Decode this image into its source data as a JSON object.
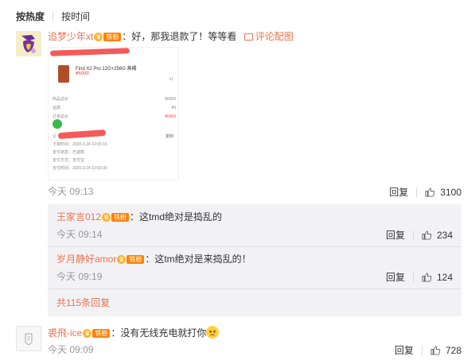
{
  "sort": {
    "active": "按热度",
    "other": "按时间"
  },
  "comments": [
    {
      "username": "追梦少年xt",
      "fan_label": "铁粉",
      "text": "：好，那我退款了！等等看",
      "pic_link": "评论配图",
      "time": "今天 09:13",
      "reply": "回复",
      "likes": "3100",
      "image": {
        "product_title": "Find X2 Pro 12G+256G 蒸橘",
        "product_price": "¥6999",
        "qty": "x1",
        "rows": [
          {
            "k": "商品总价",
            "v": "¥6999"
          },
          {
            "k": "运费",
            "v": "¥0"
          },
          {
            "k": "订单总价",
            "v": "¥6999"
          }
        ],
        "order_rows": [
          "订 单 号：",
          "下单时间：2020-3-24 10:03:16",
          "支付状态：已退款",
          "支付方式：支付宝",
          "支付时间：2020-3-24 10:03:39"
        ],
        "copy": "复制"
      },
      "replies": [
        {
          "username": "王家言012",
          "fan_label": "铁粉",
          "text": "：这tmd绝对是捣乱的",
          "time": "今天 09:14",
          "reply": "回复",
          "likes": "234"
        },
        {
          "username": "岁月静好amor",
          "fan_label": "铁粉",
          "text": "：这tm绝对是来捣乱的！",
          "time": "今天 09:19",
          "reply": "回复",
          "likes": "124"
        }
      ],
      "more_replies": "共115条回复"
    },
    {
      "username": "裘飛-ice",
      "fan_label": "铁粉",
      "text": "：没有无线充电就打你",
      "time": "今天 09:09",
      "reply": "回复",
      "likes": "728"
    }
  ],
  "colors": {
    "username": "#eb7350",
    "fan_badge": "#ff8200",
    "sub_bg": "#f2f2f5"
  }
}
